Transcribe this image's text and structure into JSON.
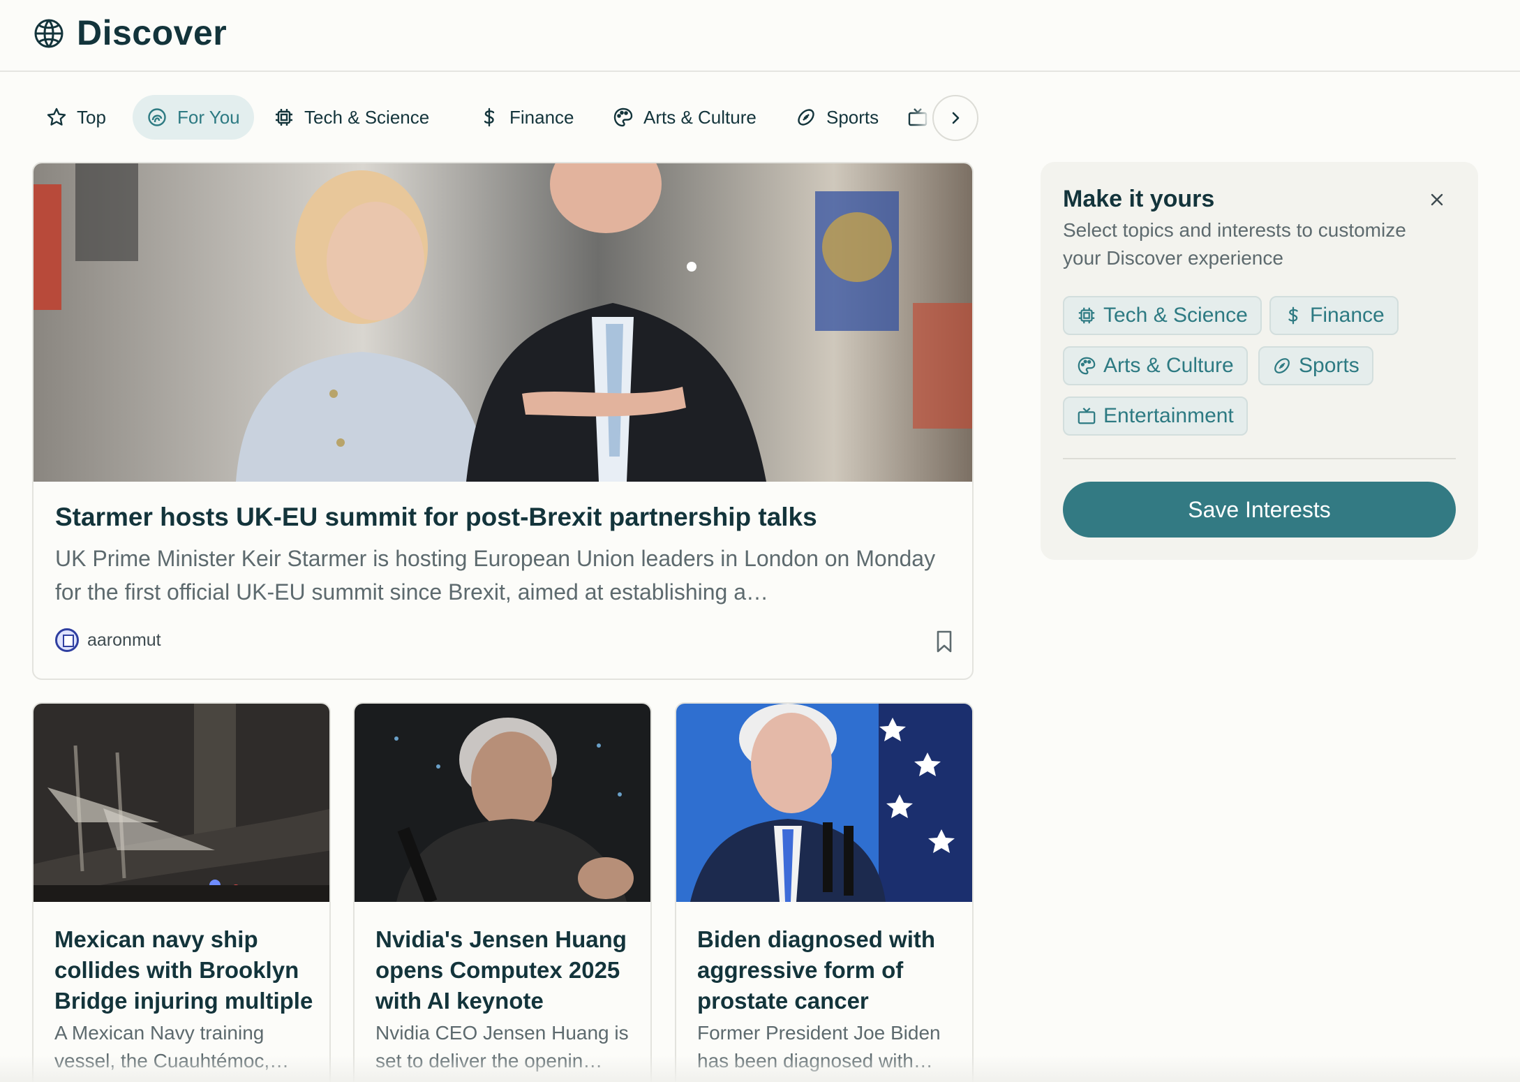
{
  "header": {
    "title": "Discover",
    "icon": "globe-icon"
  },
  "tabs": [
    {
      "label": "Top",
      "icon": "star-icon"
    },
    {
      "label": "For You",
      "icon": "for-you-icon",
      "active": true
    },
    {
      "label": "Tech & Science",
      "icon": "cpu-icon"
    },
    {
      "label": "Finance",
      "icon": "dollar-icon"
    },
    {
      "label": "Arts & Culture",
      "icon": "palette-icon"
    },
    {
      "label": "Sports",
      "icon": "football-icon"
    },
    {
      "label": "",
      "icon": "tv-icon"
    }
  ],
  "hero": {
    "title": "Starmer hosts UK-EU summit for post-Brexit partnership talks",
    "description": "UK Prime Minister Keir Starmer is hosting European Union leaders in London on Monday for the first official UK-EU summit since Brexit, aimed at establishing a…",
    "author": "aaronmut"
  },
  "cards": [
    {
      "title": "Mexican navy ship collides with Brooklyn Bridge injuring multiple",
      "description": "A Mexican Navy training vessel, the Cuauhtémoc,…"
    },
    {
      "title": "Nvidia's Jensen Huang opens Computex 2025 with AI keynote",
      "description": "Nvidia CEO Jensen Huang is set to deliver the openin…"
    },
    {
      "title": "Biden diagnosed with aggressive form of prostate cancer",
      "description": "Former President Joe Biden has been diagnosed with…"
    }
  ],
  "panel": {
    "title": "Make it yours",
    "description": "Select topics and interests to customize your Discover experience",
    "chips": [
      {
        "label": "Tech & Science",
        "icon": "cpu-icon"
      },
      {
        "label": "Finance",
        "icon": "dollar-icon"
      },
      {
        "label": "Arts & Culture",
        "icon": "palette-icon"
      },
      {
        "label": "Sports",
        "icon": "football-icon"
      },
      {
        "label": "Entertainment",
        "icon": "tv-icon"
      }
    ],
    "save_label": "Save Interests"
  },
  "colors": {
    "accent": "#337a83",
    "active_tab_bg": "#e3eeee",
    "text": "#13343b",
    "muted": "#5d6a6e"
  }
}
